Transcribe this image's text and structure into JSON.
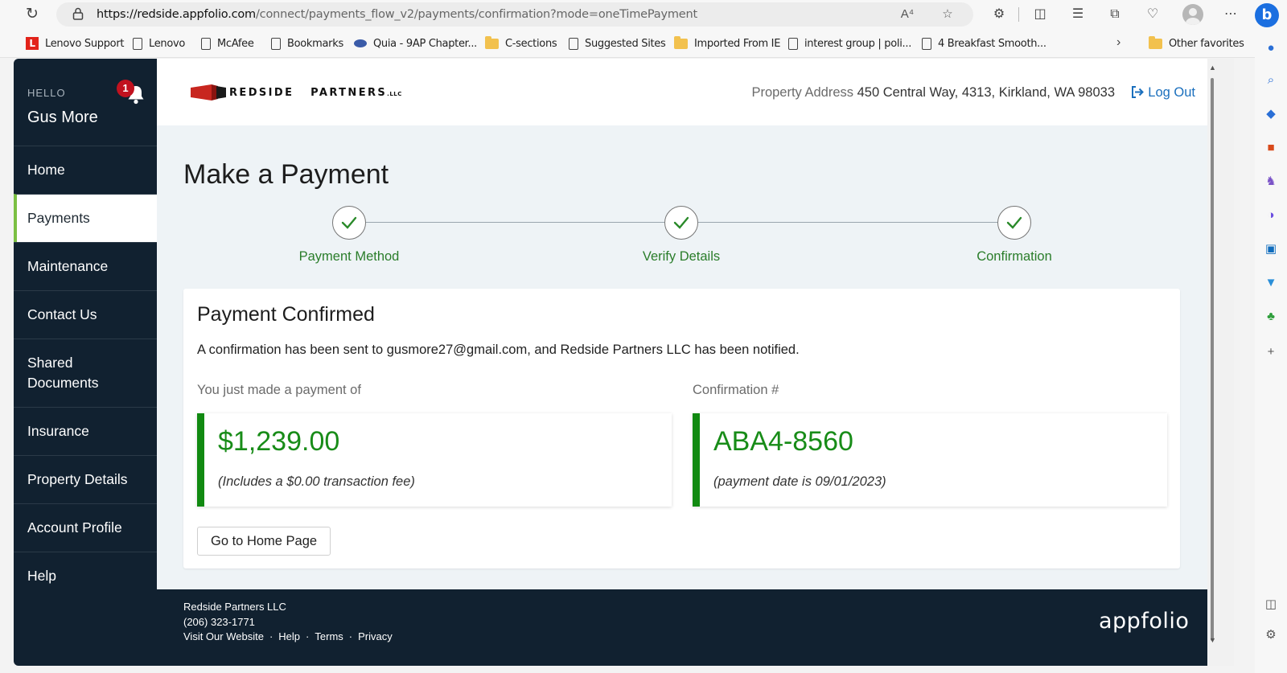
{
  "browser": {
    "url_host": "https://redside.appfolio.com",
    "url_path": "/connect/payments_flow_v2/payments/confirmation?mode=oneTimePayment",
    "bing_label": "b",
    "bookmarks": [
      {
        "label": "Lenovo Support",
        "icon": "lenovo-l"
      },
      {
        "label": "Lenovo",
        "icon": "page"
      },
      {
        "label": "McAfee",
        "icon": "page"
      },
      {
        "label": "Bookmarks",
        "icon": "page"
      },
      {
        "label": "Quia - 9AP Chapter...",
        "icon": "quia"
      },
      {
        "label": "C-sections",
        "icon": "folder"
      },
      {
        "label": "Suggested Sites",
        "icon": "page"
      },
      {
        "label": "Imported From IE",
        "icon": "folder"
      },
      {
        "label": "interest group | poli...",
        "icon": "page"
      },
      {
        "label": "4 Breakfast Smooth...",
        "icon": "page"
      }
    ],
    "other_favorites": "Other favorites"
  },
  "sidebar": {
    "hello": "HELLO",
    "user_name": "Gus More",
    "notification_count": "1",
    "items": [
      {
        "label": "Home"
      },
      {
        "label": "Payments"
      },
      {
        "label": "Maintenance"
      },
      {
        "label": "Contact Us"
      },
      {
        "label": "Shared Documents"
      },
      {
        "label": "Insurance"
      },
      {
        "label": "Property Details"
      },
      {
        "label": "Account Profile"
      },
      {
        "label": "Help"
      }
    ]
  },
  "header": {
    "brand": "REDSIDE   PARTNERS",
    "brand_suffix": ".LLC",
    "address_label": "Property Address",
    "address_value": "450 Central Way, 4313, Kirkland, WA 98033",
    "logout": "Log Out"
  },
  "page": {
    "title": "Make a Payment",
    "steps": [
      {
        "label": "Payment Method"
      },
      {
        "label": "Verify Details"
      },
      {
        "label": "Confirmation"
      }
    ]
  },
  "confirmation": {
    "title": "Payment Confirmed",
    "message": "A confirmation has been sent to gusmore27@gmail.com, and Redside Partners LLC has been notified.",
    "amount_label": "You just made a payment of",
    "amount": "$1,239.00",
    "fee_note": "(Includes a $0.00 transaction fee)",
    "conf_label": "Confirmation #",
    "conf_number": "ABA4-8560",
    "date_note": "(payment date is 09/01/2023)",
    "home_button": "Go to Home Page"
  },
  "footer": {
    "company": "Redside Partners LLC",
    "phone": "(206) 323-1771",
    "links": [
      "Visit Our Website",
      "Help",
      "Terms",
      "Privacy"
    ],
    "brand": "appfolio"
  },
  "colors": {
    "sidebar_bg": "#112130",
    "accent_green": "#188c18",
    "active_bar": "#7bc043",
    "link_blue": "#1a6fbd",
    "badge_red": "#c1121f"
  }
}
